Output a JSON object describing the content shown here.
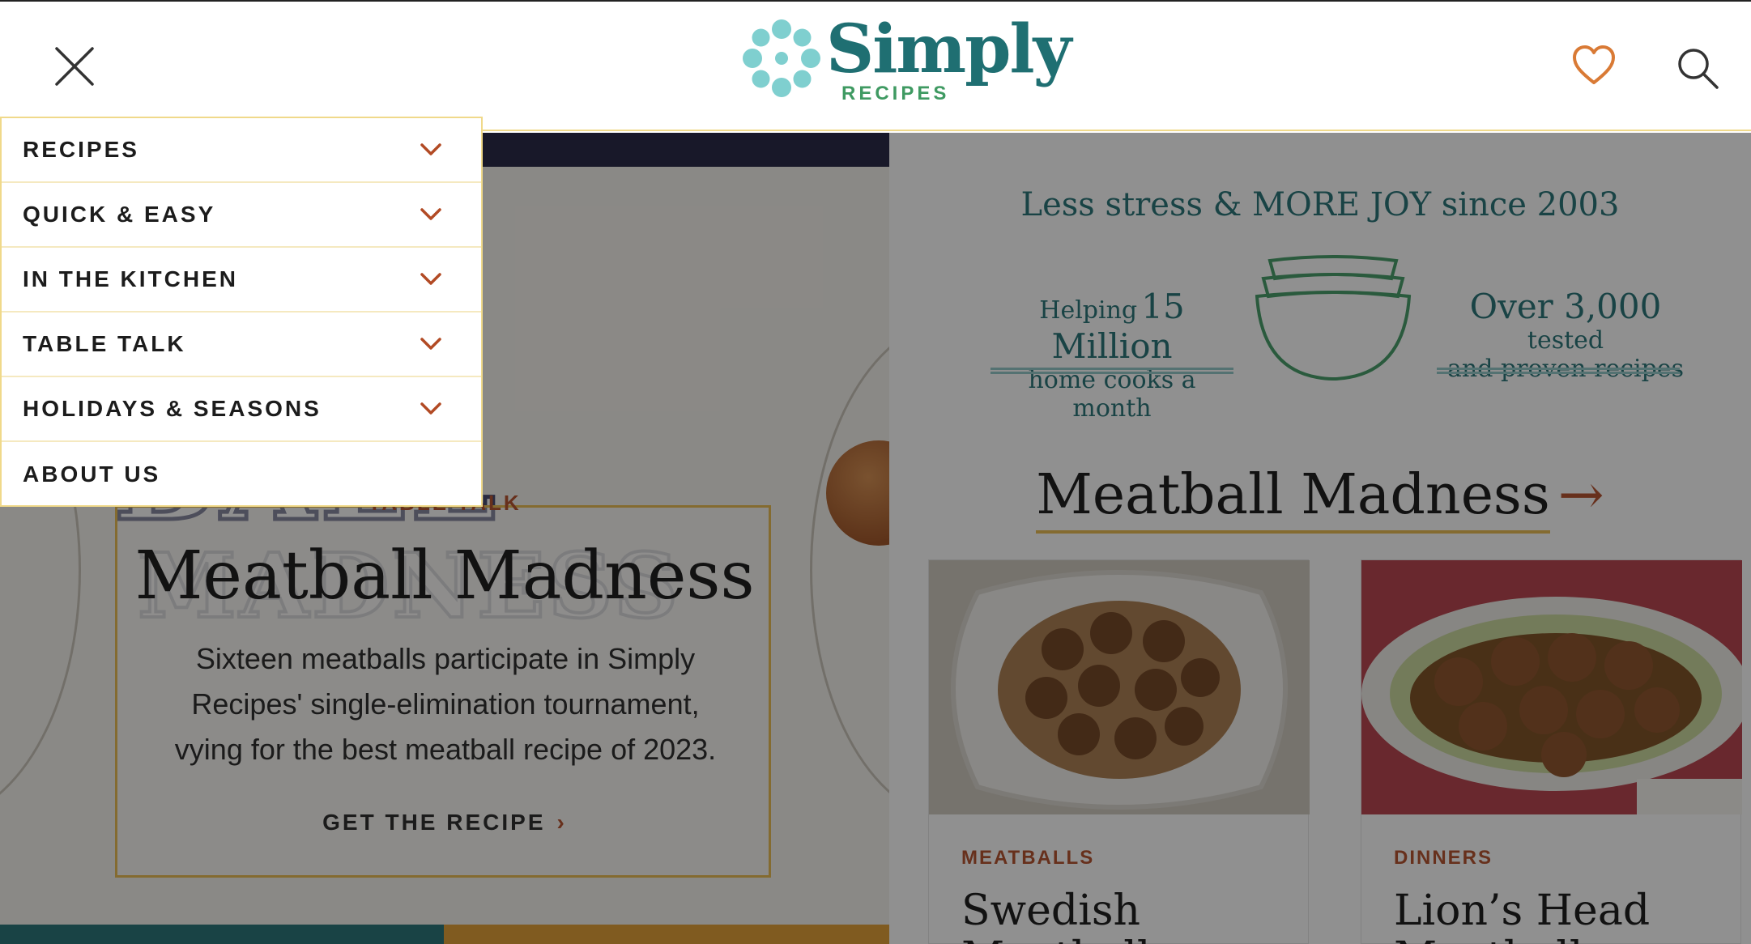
{
  "header": {
    "logo_word": "Simply",
    "logo_sub": "RECIPES",
    "close_icon": "close-icon",
    "favorites_icon": "heart-icon",
    "search_icon": "search-icon"
  },
  "menu": {
    "items": [
      {
        "label": "RECIPES",
        "expandable": true
      },
      {
        "label": "QUICK & EASY",
        "expandable": true
      },
      {
        "label": "IN THE KITCHEN",
        "expandable": true
      },
      {
        "label": "TABLE TALK",
        "expandable": true
      },
      {
        "label": "HOLIDAYS & SEASONS",
        "expandable": true
      },
      {
        "label": "ABOUT US",
        "expandable": false
      }
    ]
  },
  "hero": {
    "background_text_line1": "BALL",
    "background_text_line2": "MADNESS",
    "eyebrow": "TABLE TALK",
    "title": "Meatball Madness",
    "description": "Sixteen meatballs participate in Simply Recipes' single-elimination tournament, vying for the best meatball recipe of 2023.",
    "cta": "GET THE RECIPE"
  },
  "tagline": {
    "main": "Less stress & MORE JOY since 2003",
    "left_prefix": "Helping",
    "left_big": "15 Million",
    "left_small": "home cooks a month",
    "right_big": "Over 3,000",
    "right_suffix": "tested",
    "right_small": "and proven recipes"
  },
  "section": {
    "title": "Meatball Madness",
    "arrow": "→"
  },
  "cards": [
    {
      "eyebrow": "MEATBALLS",
      "title": "Swedish Meatballs"
    },
    {
      "eyebrow": "DINNERS",
      "title": "Lion’s Head Meatballs"
    }
  ],
  "colors": {
    "brand_teal": "#1f6f72",
    "brand_green": "#3f9a62",
    "accent_rust": "#b24a24",
    "accent_gold": "#e8b94a",
    "logo_flower": "#7fcfcf"
  }
}
